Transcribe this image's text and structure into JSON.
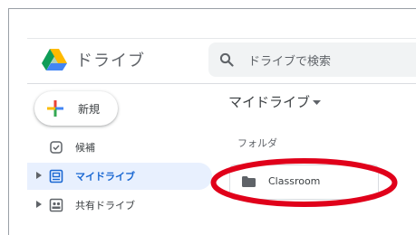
{
  "app": {
    "name": "ドライブ"
  },
  "search": {
    "placeholder": "ドライブで検索"
  },
  "new_button": {
    "label": "新規"
  },
  "sidebar": {
    "items": [
      {
        "label": "候補",
        "icon": "check-box-icon",
        "active": false
      },
      {
        "label": "マイドライブ",
        "icon": "drive-icon",
        "active": true
      },
      {
        "label": "共有ドライブ",
        "icon": "shared-drive-icon",
        "active": false
      }
    ]
  },
  "main": {
    "title": "マイドライブ",
    "sections": [
      {
        "label": "フォルダ",
        "folders": [
          {
            "name": "Classroom",
            "icon": "folder-icon"
          }
        ]
      }
    ]
  },
  "colors": {
    "accent": "#1967d2",
    "active_bg": "#e8f0fe",
    "annotation": "#e0001a",
    "search_bg": "#f1f3f4"
  }
}
